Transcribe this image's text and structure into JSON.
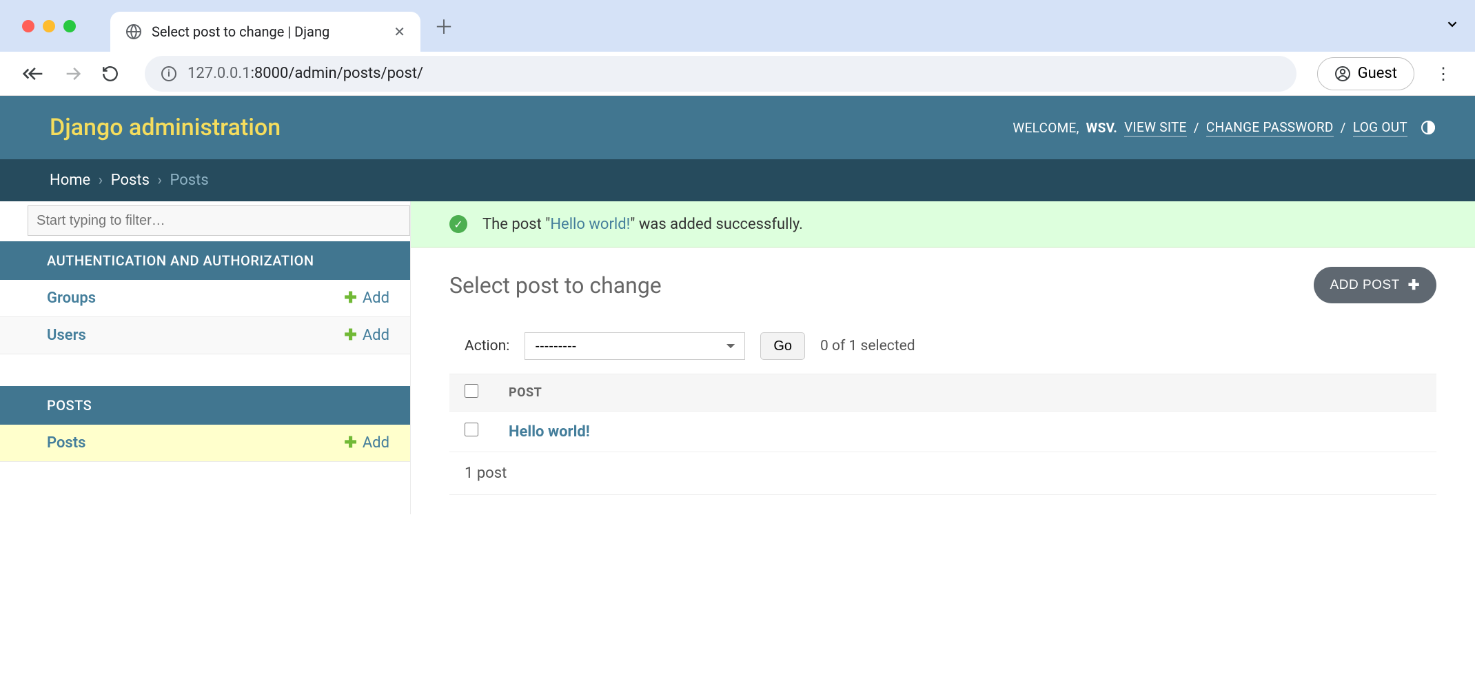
{
  "browser": {
    "tab_title": "Select post to change | Djang",
    "url_muted1": "127.0.0.1",
    "url_rest": ":8000/admin/posts/post/",
    "guest_label": "Guest"
  },
  "header": {
    "title": "Django administration",
    "welcome": "WELCOME,",
    "username": "WSV",
    "view_site": "VIEW SITE",
    "change_password": "CHANGE PASSWORD",
    "logout": "LOG OUT"
  },
  "breadcrumbs": {
    "home": "Home",
    "posts_app": "Posts",
    "current": "Posts"
  },
  "sidebar": {
    "filter_placeholder": "Start typing to filter…",
    "apps": [
      {
        "caption": "AUTHENTICATION AND AUTHORIZATION",
        "models": [
          {
            "name": "Groups",
            "add": "Add"
          },
          {
            "name": "Users",
            "add": "Add"
          }
        ]
      },
      {
        "caption": "POSTS",
        "models": [
          {
            "name": "Posts",
            "add": "Add",
            "selected": true
          }
        ]
      }
    ]
  },
  "message": {
    "pre": "The post \"",
    "link": "Hello world!",
    "post": "\" was added successfully."
  },
  "main": {
    "title": "Select post to change",
    "add_button": "ADD POST",
    "action_label": "Action:",
    "action_placeholder": "---------",
    "go": "Go",
    "selection_count": "0 of 1 selected",
    "column_header": "POST",
    "rows": [
      {
        "title": "Hello world!"
      }
    ],
    "paginator": "1 post"
  }
}
